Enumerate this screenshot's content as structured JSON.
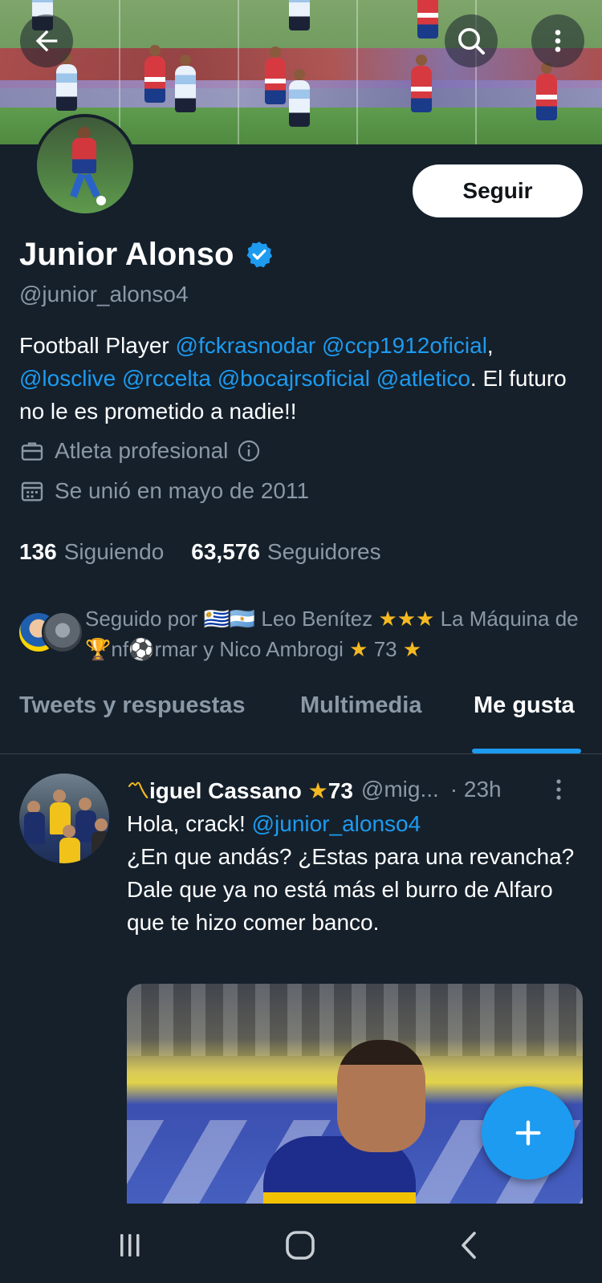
{
  "header": {
    "back_icon": "arrow-left-icon",
    "search_icon": "search-icon",
    "more_icon": "more-vertical-icon"
  },
  "profile": {
    "follow_label": "Seguir",
    "name": "Junior Alonso",
    "handle": "@junior_alonso4",
    "bio": {
      "p1": "Football Player ",
      "m1": "@fckrasnodar",
      "s1": " ",
      "m2": "@ccp1912oficial",
      "s2": ", ",
      "m3": "@losclive",
      "s3": " ",
      "m4": "@rccelta",
      "s4": " ",
      "m5": "@bocajrsoficial",
      "s5": " ",
      "m6": "@atletico",
      "p2": ". El futuro no le es prometido a nadie!!"
    },
    "profession": "Atleta profesional",
    "joined": "Se unió en mayo de 2011",
    "following_count": "136",
    "following_label": "Siguiendo",
    "followers_count": "63,576",
    "followers_label": "Seguidores",
    "followed_by": {
      "prefix": "Seguido por ",
      "flags": "🇺🇾🇦🇷",
      "person1": " Leo Benítez ",
      "stars1": "★★★",
      "person2": " La Máquina de ",
      "trophy": "🏆",
      "nf": "nf",
      "ball": "⚽",
      "rest": "rmar y Nico Ambrogi ",
      "star2": "★",
      "num": " 73 ",
      "star3": "★"
    }
  },
  "tabs": [
    {
      "label": "Tweets y respuestas"
    },
    {
      "label": "Multimedia"
    },
    {
      "label": "Me gusta"
    }
  ],
  "tweet": {
    "name_glyph": "〽",
    "name": "iguel Cassano ",
    "name_star": "★",
    "name_num": "73",
    "handle": "@mig...",
    "time": "· 23h",
    "line1_prefix": "Hola, crack! ",
    "line1_mention": "@junior_alonso4",
    "rest": "¿En que andás? ¿Estas para una revancha?\nDale que ya no está más el burro de Alfaro que te hizo comer banco."
  },
  "colors": {
    "background": "#15202b",
    "accent": "#1d9bf0",
    "muted": "#8b98a5",
    "star": "#f5b921"
  }
}
